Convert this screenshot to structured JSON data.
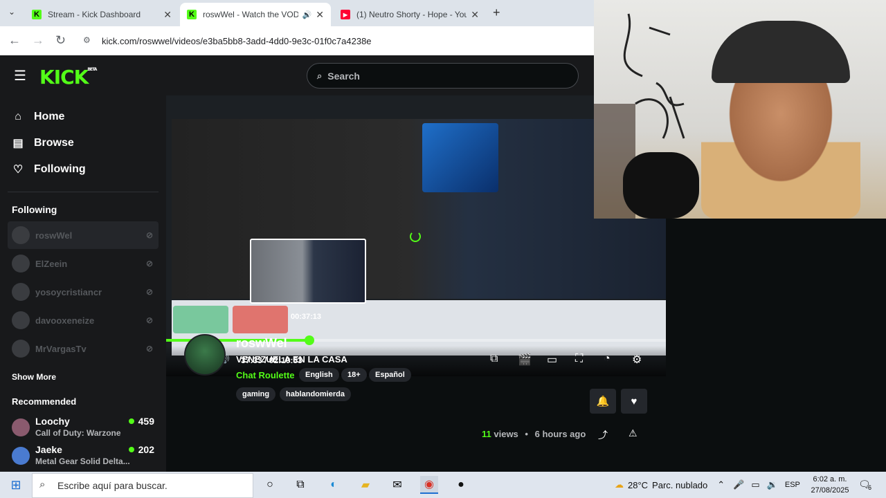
{
  "browser": {
    "tabs": [
      {
        "title": "Stream - Kick Dashboard",
        "icon": "kick-icon",
        "active": false
      },
      {
        "title": "roswWel - Watch the VOD o",
        "icon": "kick-icon",
        "active": true
      },
      {
        "title": "(1) Neutro Shorty - Hope - You",
        "icon": "youtube-icon",
        "active": false
      }
    ],
    "new_tab": "+",
    "url": "kick.com/roswwel/videos/e3ba5bb8-3add-4dd0-9e3c-01f0c7a4238e"
  },
  "kick": {
    "logo": "KICK",
    "logo_badge": "BETA",
    "search_placeholder": "Search",
    "nav": [
      {
        "label": "Home",
        "icon": "home-icon"
      },
      {
        "label": "Browse",
        "icon": "browse-icon"
      },
      {
        "label": "Following",
        "icon": "heart-icon"
      }
    ],
    "following_heading": "Following",
    "following": [
      {
        "name": "roswWel",
        "selected": true
      },
      {
        "name": "ElZeein",
        "selected": false
      },
      {
        "name": "yosoycristiancr",
        "selected": false
      },
      {
        "name": "davooxeneize",
        "selected": false
      },
      {
        "name": "MrVargasTv",
        "selected": false
      }
    ],
    "show_more": "Show More",
    "recommended_heading": "Recommended",
    "recommended": [
      {
        "name": "Loochy",
        "category": "Call of Duty: Warzone",
        "viewers": "459"
      },
      {
        "name": "Jaeke",
        "category": "Metal Gear Solid Delta...",
        "viewers": "202"
      }
    ],
    "accent": "#53fc18"
  },
  "player": {
    "hover_time": "00:37:13",
    "timecode": "37:33 / 02:10:53",
    "progress": 0.287
  },
  "vod": {
    "channel": "roswWel",
    "title": "VENEZUELA EN LA CASA",
    "category": "Chat Roulette",
    "tags": [
      "English",
      "18+",
      "Español",
      "gaming",
      "hablandomierda"
    ],
    "views_count": "11",
    "views_label": "views",
    "separator": "•",
    "age": "6 hours ago"
  },
  "taskbar": {
    "search_placeholder": "Escribe aquí para buscar.",
    "temperature": "28°C",
    "weather": "Parc. nublado",
    "language": "ESP",
    "time": "6:02 a. m.",
    "date": "27/08/2025",
    "notifications": "6"
  }
}
